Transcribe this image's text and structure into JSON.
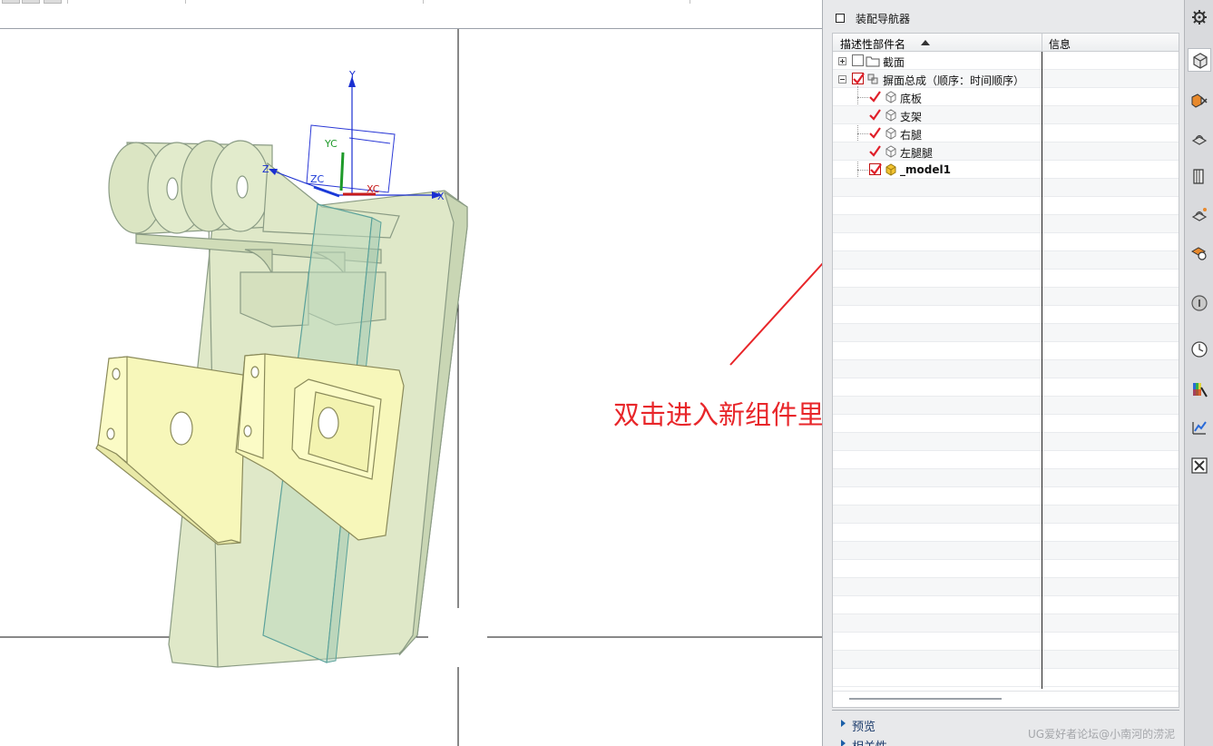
{
  "viewport": {
    "annotation": "双击进入新组件里面建模",
    "axes": {
      "x": "X",
      "y": "Y",
      "z": "Z",
      "xc": "XC",
      "yc": "YC",
      "zc": "ZC"
    }
  },
  "navigator": {
    "title": "装配导航器",
    "columns": {
      "name": "描述性部件名",
      "info": "信息"
    },
    "rows": [
      {
        "label": "截面",
        "icon": "folder-icon",
        "checked": false,
        "expander": "+"
      },
      {
        "label": "摒面总成（顺序：时间顺序）",
        "icon": "assembly-icon",
        "checked": true,
        "expander": "-"
      },
      {
        "label": "底板",
        "icon": "part-icon",
        "checked": true
      },
      {
        "label": "支架",
        "icon": "part-icon",
        "checked": true
      },
      {
        "label": "右腿",
        "icon": "part-icon",
        "checked": true
      },
      {
        "label": "左腿腿",
        "icon": "part-icon",
        "checked": true
      },
      {
        "label": "_model1",
        "icon": "work-part-icon",
        "checked": true
      }
    ],
    "sections": {
      "preview": "预览",
      "dependencies": "相关性"
    }
  },
  "resource_bar": {
    "icons": [
      "settings-icon",
      "assembly-navigator-icon",
      "constraint-navigator-icon",
      "part-navigator-icon",
      "reuse-library-icon",
      "hd3d-tools-icon",
      "web-browser-icon",
      "history-icon",
      "clock-icon",
      "system-materials-icon",
      "process-studio-icon",
      "roles-icon"
    ]
  },
  "colors": {
    "annotation": "#e8262a",
    "model_face": "#e3ebcf",
    "bracket_face": "#fbfbc2",
    "check": "#e0202a"
  },
  "watermark": "UG爱好者论坛@小南河的涝泥"
}
